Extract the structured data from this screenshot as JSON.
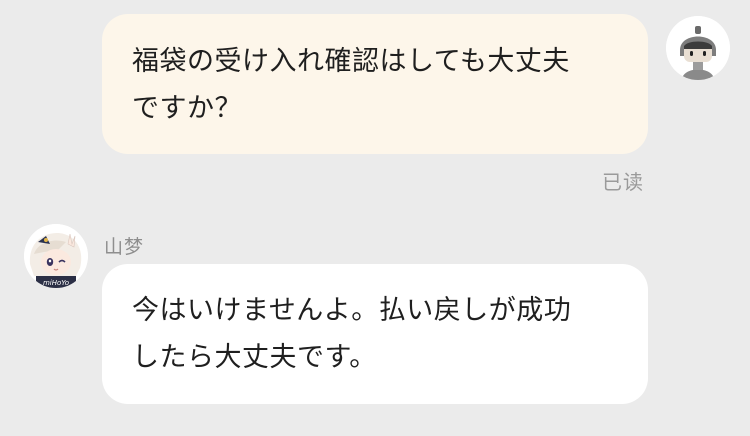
{
  "chat": {
    "outgoing": {
      "lines": [
        "福袋の受け入れ確認はしても大丈夫",
        "ですか？"
      ],
      "status": "已读",
      "avatar_icon": "robot-avatar-icon",
      "bubble_color": "#fdf6ea"
    },
    "incoming": {
      "sender": "山梦",
      "lines": [
        "今はいけませんよ。払い戻しが成功",
        "したら大丈夫です。"
      ],
      "avatar_icon": "paimon-avatar-icon",
      "avatar_badge": "miHoYo",
      "bubble_color": "#ffffff"
    },
    "background_color": "#ebebeb"
  }
}
